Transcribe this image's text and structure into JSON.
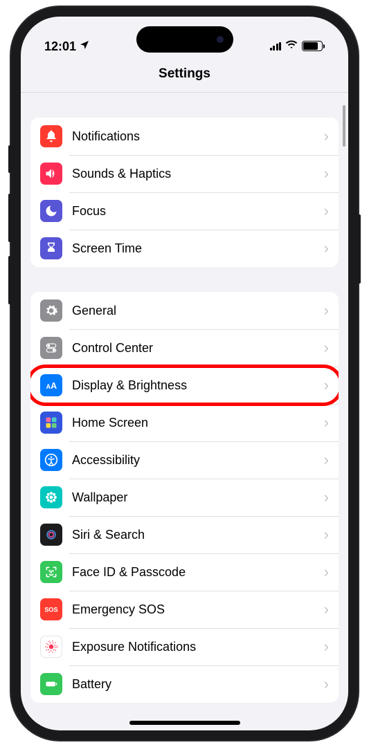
{
  "status": {
    "time": "12:01",
    "battery_percent": "80"
  },
  "nav": {
    "title": "Settings"
  },
  "groups": [
    {
      "rows": [
        {
          "id": "notifications",
          "label": "Notifications",
          "icon": "bell-icon",
          "bg": "#ff3b30"
        },
        {
          "id": "sounds-haptics",
          "label": "Sounds & Haptics",
          "icon": "speaker-icon",
          "bg": "#ff2d55"
        },
        {
          "id": "focus",
          "label": "Focus",
          "icon": "moon-icon",
          "bg": "#5856d6"
        },
        {
          "id": "screen-time",
          "label": "Screen Time",
          "icon": "hourglass-icon",
          "bg": "#5856d6"
        }
      ]
    },
    {
      "rows": [
        {
          "id": "general",
          "label": "General",
          "icon": "gear-icon",
          "bg": "#8e8e93"
        },
        {
          "id": "control-center",
          "label": "Control Center",
          "icon": "toggles-icon",
          "bg": "#8e8e93"
        },
        {
          "id": "display-brightness",
          "label": "Display & Brightness",
          "icon": "text-size-icon",
          "bg": "#007aff",
          "highlight": true
        },
        {
          "id": "home-screen",
          "label": "Home Screen",
          "icon": "grid-icon",
          "bg": "#3355dd"
        },
        {
          "id": "accessibility",
          "label": "Accessibility",
          "icon": "accessibility-icon",
          "bg": "#007aff"
        },
        {
          "id": "wallpaper",
          "label": "Wallpaper",
          "icon": "flower-icon",
          "bg": "#00c7be"
        },
        {
          "id": "siri-search",
          "label": "Siri & Search",
          "icon": "siri-icon",
          "bg": "#1c1c1e"
        },
        {
          "id": "face-id-passcode",
          "label": "Face ID & Passcode",
          "icon": "face-id-icon",
          "bg": "#34c759"
        },
        {
          "id": "emergency-sos",
          "label": "Emergency SOS",
          "icon": "sos-icon",
          "bg": "#ff3b30"
        },
        {
          "id": "exposure-notifications",
          "label": "Exposure Notifications",
          "icon": "exposure-icon",
          "bg": "#ffffff"
        },
        {
          "id": "battery",
          "label": "Battery",
          "icon": "battery-icon",
          "bg": "#34c759"
        }
      ]
    }
  ],
  "icons": {
    "bell-icon": "<svg viewBox='0 0 24 24' width='20' height='20' fill='white'><path d='M12 2a2 2 0 0 0-2 2c-2.5.9-4 3.3-4 6v4l-2 2v1h16v-1l-2-2v-4c0-2.7-1.5-5.1-4-6a2 2 0 0 0-2-2zm0 20a2.5 2.5 0 0 0 2.5-2.5h-5A2.5 2.5 0 0 0 12 22z'/></svg>",
    "speaker-icon": "<svg viewBox='0 0 24 24' width='20' height='20' fill='white'><path d='M3 9v6h4l5 5V4L7 9H3zm13 3a4 4 0 0 0-2-3.5v7A4 4 0 0 0 16 12zm-2-7v2a7 7 0 0 1 0 10v2a9 9 0 0 0 0-14z'/></svg>",
    "moon-icon": "<svg viewBox='0 0 24 24' width='20' height='20' fill='white'><path d='M21 12.8A9 9 0 1 1 11.2 3a7 7 0 0 0 9.8 9.8z'/></svg>",
    "hourglass-icon": "<svg viewBox='0 0 24 24' width='20' height='20' fill='white'><path d='M6 2h12v4l-4 4 4 4v4H6v-4l4-4-4-4V2zm2 2v2l4 4 4-4V4H8z'/></svg>",
    "gear-icon": "<svg viewBox='0 0 24 24' width='20' height='20' fill='white'><path d='M12 8a4 4 0 1 0 0 8 4 4 0 0 0 0-8zm9 4l2 1-1 3-2-.5a8 8 0 0 1-1.5 1.5l.5 2-3 1-1-2a8 8 0 0 1-2 0l-1 2-3-1 .5-2A8 8 0 0 1 7 16.5L5 17l-1-3 2-1a8 8 0 0 1 0-2l-2-1 1-3 2 .5A8 8 0 0 1 8.5 6L8 4l3-1 1 2a8 8 0 0 1 2 0l1-2 3 1-.5 2A8 8 0 0 1 19 8.5l2-.5 1 3-2 1a8 8 0 0 1 0 2z'/></svg>",
    "toggles-icon": "<svg viewBox='0 0 24 24' width='18' height='18' fill='white'><rect x='3' y='4' width='18' height='7' rx='3.5' fill='none' stroke='white' stroke-width='1.5'/><circle cx='7' cy='7.5' r='2.5'/><rect x='3' y='13' width='18' height='7' rx='3.5' fill='none' stroke='white' stroke-width='1.5'/><circle cx='17' cy='16.5' r='2.5'/></svg>",
    "text-size-icon": "<svg viewBox='0 0 24 24' width='20' height='20' fill='white'><text x='3' y='18' font-size='11' font-weight='700' fill='white'>A</text><text x='11' y='18' font-size='15' font-weight='700' fill='white'>A</text></svg>",
    "grid-icon": "<svg viewBox='0 0 24 24' width='20' height='20'><rect x='3' y='3' width='8' height='8' rx='2' fill='#ff6b9d'/><rect x='13' y='3' width='8' height='8' rx='2' fill='#4ecdc4'/><rect x='3' y='13' width='8' height='8' rx='2' fill='#ffd93d'/><rect x='13' y='13' width='8' height='8' rx='2' fill='#6bcf7f'/></svg>",
    "accessibility-icon": "<svg viewBox='0 0 24 24' width='20' height='20' fill='white'><circle cx='12' cy='12' r='10' fill='none' stroke='white' stroke-width='2'/><circle cx='12' cy='7' r='1.5'/><path d='M7 10l5 1 5-1M12 11v5m-3 4l3-4 3 4' stroke='white' stroke-width='1.8' fill='none' stroke-linecap='round'/></svg>",
    "flower-icon": "<svg viewBox='0 0 24 24' width='20' height='20' fill='white'><circle cx='12' cy='12' r='3'/><circle cx='12' cy='5' r='2.5'/><circle cx='12' cy='19' r='2.5'/><circle cx='5' cy='12' r='2.5'/><circle cx='19' cy='12' r='2.5'/><circle cx='7' cy='7' r='2.5'/><circle cx='17' cy='7' r='2.5'/><circle cx='7' cy='17' r='2.5'/><circle cx='17' cy='17' r='2.5'/></svg>",
    "siri-icon": "<svg viewBox='0 0 24 24' width='20' height='20'><circle cx='12' cy='12' r='9' fill='#1c1c1e'/><circle cx='12' cy='12' r='7' fill='none' stroke='#4a90e2' stroke-width='2'/><circle cx='12' cy='12' r='4' fill='none' stroke='#e94b9a' stroke-width='2'/></svg>",
    "face-id-icon": "<svg viewBox='0 0 24 24' width='20' height='20' fill='none' stroke='white' stroke-width='2' stroke-linecap='round'><path d='M4 8V5a1 1 0 0 1 1-1h3M20 8V5a1 1 0 0 0-1-1h-3M4 16v3a1 1 0 0 0 1 1h3M20 16v3a1 1 0 0 1-1 1h-3'/><circle cx='9' cy='10' r='0.5' fill='white'/><circle cx='15' cy='10' r='0.5' fill='white'/><path d='M12 10v3h-1M9 16s1 1.5 3 1.5 3-1.5 3-1.5'/></svg>",
    "sos-icon": "<svg viewBox='0 0 24 24' width='22' height='22'><text x='12' y='16' text-anchor='middle' font-size='10' font-weight='800' fill='white'>SOS</text></svg>",
    "exposure-icon": "<svg viewBox='0 0 24 24' width='20' height='20'><circle cx='12' cy='12' r='4' fill='#ff3756'/><circle cx='12' cy='12' r='7' fill='none' stroke='#ff3756' stroke-width='1.5' stroke-dasharray='2 3'/><circle cx='12' cy='12' r='10' fill='none' stroke='#ff3756' stroke-width='1.2' stroke-dasharray='2 4'/></svg>",
    "battery-icon": "<svg viewBox='0 0 24 24' width='20' height='20' fill='white'><rect x='3' y='8' width='16' height='8' rx='2' fill='white'/><rect x='20' y='10' width='2' height='4' rx='1'/></svg>",
    "location-arrow-icon": "<svg viewBox='0 0 24 24' width='16' height='16' fill='black'><path d='M3 11l18-8-8 18-2-8-8-2z'/></svg>",
    "wifi-icon": "<svg viewBox='0 0 24 24' width='18' height='18' fill='black'><path d='M12 20l2-2a3 3 0 0 0-4 0l2 2zm-5-5a7 7 0 0 1 10 0l2-2a10 10 0 0 0-14 0l2 2zm-4-4a13 13 0 0 1 18 0l2-2a16 16 0 0 0-22 0l2 2z'/></svg>"
  }
}
